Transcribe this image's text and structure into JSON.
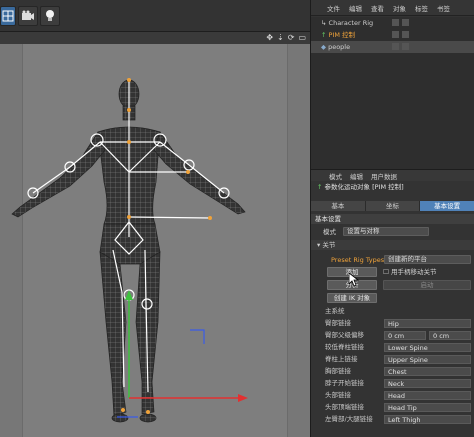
{
  "toolbar": {
    "icons": [
      "grid-view-icon",
      "camera-icon",
      "light-bulb-icon"
    ]
  },
  "viewport": {
    "nav_icons": [
      "move-icon",
      "zoom-icon",
      "rotate-icon",
      "maximize-icon"
    ]
  },
  "objects_panel": {
    "menu": [
      "文件",
      "编辑",
      "查看",
      "对象",
      "标签",
      "书签"
    ],
    "items": [
      {
        "label": "Character Rig",
        "selected": false
      },
      {
        "label": "PIM 控制",
        "selected": false,
        "highlight": "#f0a33a"
      },
      {
        "label": "people",
        "selected": true
      }
    ]
  },
  "attributes": {
    "menu": [
      "模式",
      "编辑",
      "用户数据"
    ],
    "title": "参数化运动对象 [PIM 控制]",
    "tabs": [
      "基本",
      "坐标",
      "基本设置"
    ],
    "active_tab": 2,
    "section": "基本设置",
    "mode_label": "模式",
    "mode_value": "设置与对称",
    "subsection": "关节",
    "preset_label": "Preset Rig Types",
    "preset_value": "创建新的平台",
    "btn_left_1": "添加",
    "btn_left_2": "分析",
    "checkbox_label": "用手柄移动关节",
    "btn_right": "启动",
    "btn_create": "创建 IK 对象",
    "fields": [
      {
        "label": "主系统",
        "value": ""
      },
      {
        "label": "臀部链接",
        "value": "Hip"
      },
      {
        "label": "臀部父级偏移",
        "value": "0 cm",
        "value2": "0 cm"
      },
      {
        "label": "较低脊柱链接",
        "value": "Lower Spine"
      },
      {
        "label": "脊柱上链接",
        "value": "Upper Spine"
      },
      {
        "label": "胸部链接",
        "value": "Chest"
      },
      {
        "label": "脖子开始链接",
        "value": "Neck"
      },
      {
        "label": "头部链接",
        "value": "Head"
      },
      {
        "label": "头部顶端链接",
        "value": "Head Tip"
      },
      {
        "label": "左臀部/大腿链接",
        "value": "Left Thigh"
      }
    ]
  },
  "colors": {
    "accent": "#5082b8",
    "joint_orange": "#f0a33a",
    "axis_red": "#e23030",
    "axis_green": "#3ec13e",
    "axis_blue": "#3a5ce8"
  }
}
